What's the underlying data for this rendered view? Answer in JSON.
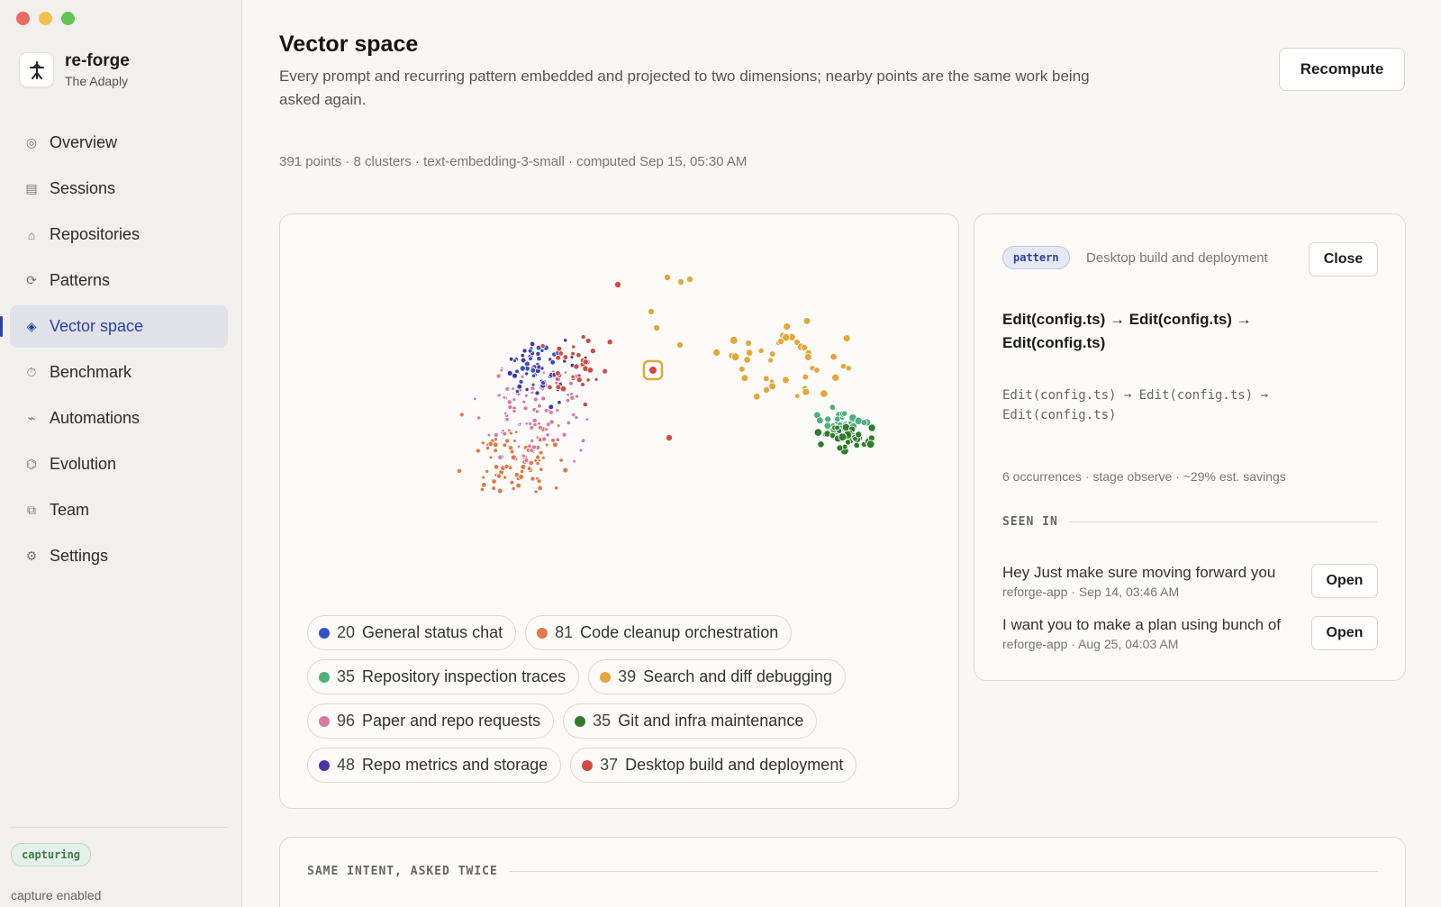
{
  "window": {
    "controls": [
      "close",
      "minimize",
      "maximize"
    ]
  },
  "brand": {
    "name": "re-forge",
    "subtitle": "The Adaply",
    "logo_icon": "anvil-icon"
  },
  "sidebar": {
    "items": [
      {
        "label": "Overview",
        "icon": "target-icon",
        "active": false
      },
      {
        "label": "Sessions",
        "icon": "list-icon",
        "active": false
      },
      {
        "label": "Repositories",
        "icon": "home-icon",
        "active": false
      },
      {
        "label": "Patterns",
        "icon": "cycle-icon",
        "active": false
      },
      {
        "label": "Vector space",
        "icon": "diamond-icon",
        "active": true
      },
      {
        "label": "Benchmark",
        "icon": "timer-icon",
        "active": false
      },
      {
        "label": "Automations",
        "icon": "bolt-icon",
        "active": false
      },
      {
        "label": "Evolution",
        "icon": "branch-icon",
        "active": false
      },
      {
        "label": "Team",
        "icon": "people-icon",
        "active": false
      },
      {
        "label": "Settings",
        "icon": "gear-icon",
        "active": false
      }
    ],
    "status_badge": "capturing",
    "status_text": "capture enabled"
  },
  "header": {
    "title": "Vector space",
    "description": "Every prompt and recurring pattern embedded and projected to two dimensions; nearby points are the same work being asked again.",
    "recompute_label": "Recompute",
    "meta": "391 points · 8 clusters · text-embedding-3-small · computed Sep 15, 05:30 AM"
  },
  "chart_data": {
    "type": "scatter",
    "title": "",
    "xlabel": "",
    "ylabel": "",
    "grid": false,
    "legend_placement": "bottom",
    "clusters": [
      {
        "count": "20",
        "name": "General status chat",
        "color": "#3552c9"
      },
      {
        "count": "81",
        "name": "Code cleanup orchestration",
        "color": "#e07a46"
      },
      {
        "count": "35",
        "name": "Repository inspection traces",
        "color": "#4fb07e"
      },
      {
        "count": "39",
        "name": "Search and diff debugging",
        "color": "#e5a73a"
      },
      {
        "count": "96",
        "name": "Paper and repo requests",
        "color": "#d97aa6"
      },
      {
        "count": "35",
        "name": "Git and infra maintenance",
        "color": "#2f7d2a"
      },
      {
        "count": "48",
        "name": "Repo metrics and storage",
        "color": "#4638a4"
      },
      {
        "count": "37",
        "name": "Desktop build and deployment",
        "color": "#d14b43"
      }
    ],
    "selected_cluster": "Desktop build and deployment"
  },
  "detail": {
    "tag": "pattern",
    "cluster_label": "Desktop build and deployment",
    "close_label": "Close",
    "title": "Edit(config.ts) → Edit(config.ts) → Edit(config.ts)",
    "code": "Edit(config.ts) → Edit(config.ts) → Edit(config.ts)",
    "meta": "6 occurrences · stage observe · ~29% est. savings",
    "seen_in_label": "SEEN IN",
    "seen_in": [
      {
        "text": "Hey Just make sure moving forward you",
        "sub": "reforge-app · Sep 14, 03:46 AM",
        "button": "Open"
      },
      {
        "text": "I want you to make a plan using bunch of",
        "sub": "reforge-app · Aug 25, 04:03 AM",
        "button": "Open"
      }
    ]
  },
  "bottom": {
    "section_label": "SAME INTENT, ASKED TWICE"
  }
}
